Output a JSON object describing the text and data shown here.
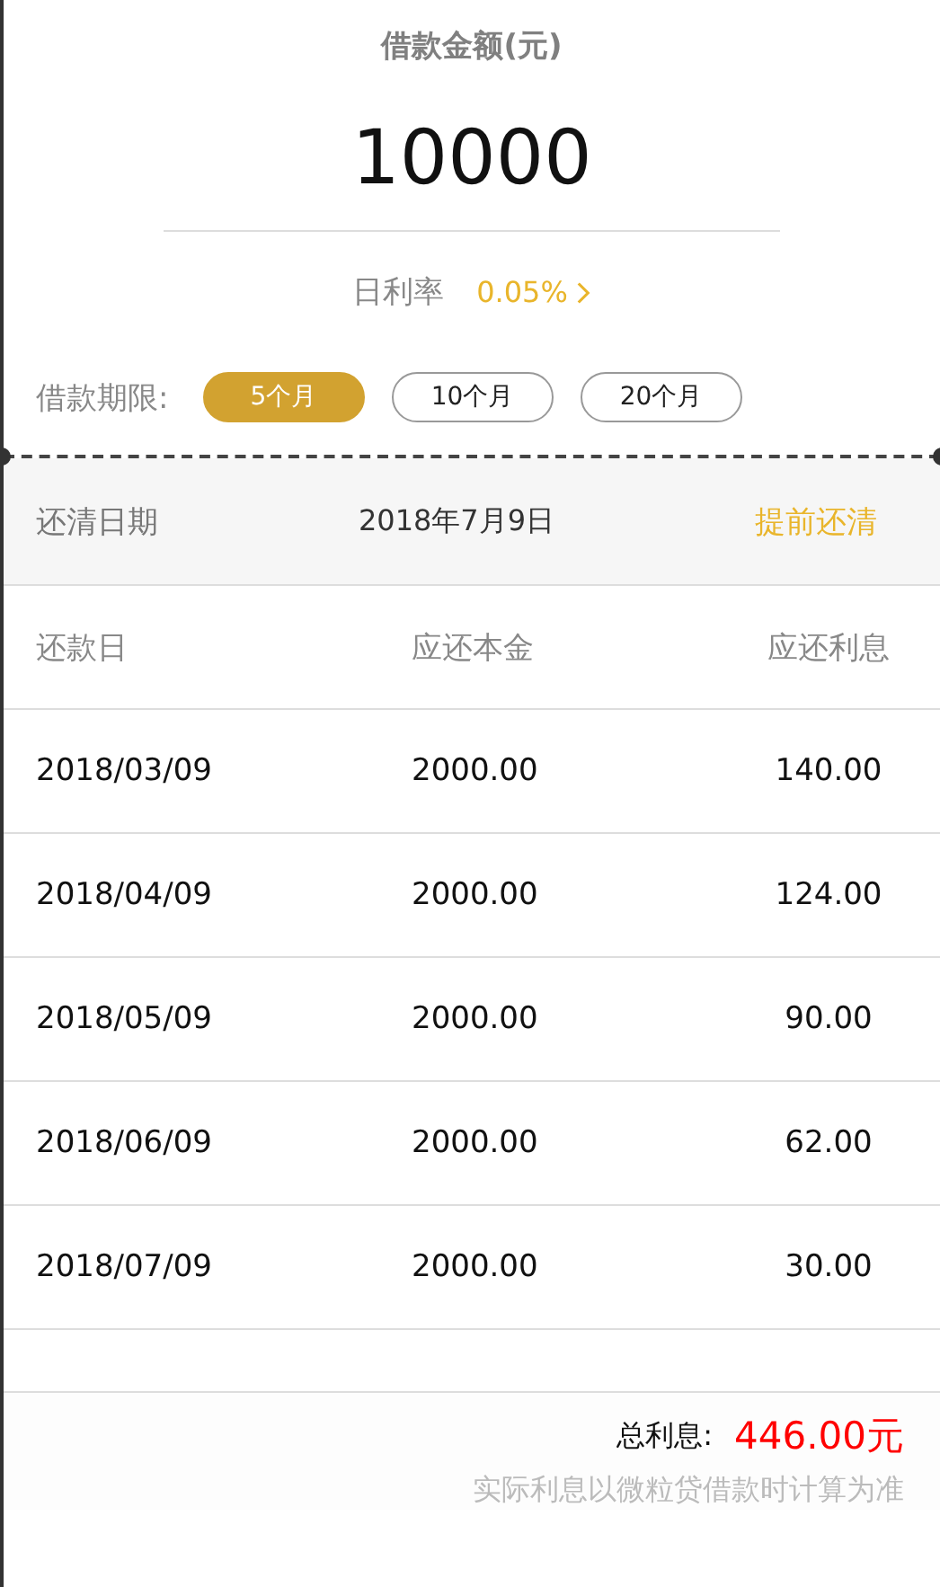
{
  "amount_title": "借款金额(元)",
  "amount": "10000",
  "daily_rate": {
    "label": "日利率",
    "value": "0.05%"
  },
  "term": {
    "label": "借款期限:",
    "options": [
      {
        "label": "5个月",
        "selected": true
      },
      {
        "label": "10个月",
        "selected": false
      },
      {
        "label": "20个月",
        "selected": false
      }
    ]
  },
  "payoff": {
    "label": "还清日期",
    "date": "2018年7月9日",
    "action": "提前还清"
  },
  "table": {
    "columns": [
      "还款日",
      "应还本金",
      "应还利息"
    ],
    "rows": [
      [
        "2018/03/09",
        "2000.00",
        "140.00"
      ],
      [
        "2018/04/09",
        "2000.00",
        "124.00"
      ],
      [
        "2018/05/09",
        "2000.00",
        "90.00"
      ],
      [
        "2018/06/09",
        "2000.00",
        "62.00"
      ],
      [
        "2018/07/09",
        "2000.00",
        "30.00"
      ]
    ]
  },
  "total": {
    "label": "总利息:",
    "value": "446.00元"
  },
  "note": "实际利息以微粒贷借款时计算为准"
}
